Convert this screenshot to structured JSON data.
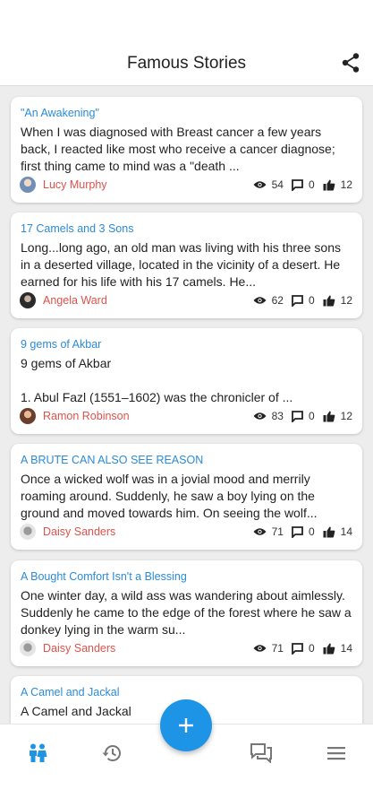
{
  "header": {
    "title": "Famous Stories"
  },
  "stories": [
    {
      "title": "\"An Awakening\"",
      "excerpt": "When I was diagnosed with Breast cancer a few years back, I reacted like most who receive a cancer diagnose; first thing came to mind was a \"death ...",
      "author": "Lucy Murphy",
      "views": "54",
      "comments": "0",
      "likes": "12"
    },
    {
      "title": "17 Camels and 3 Sons",
      "excerpt": "Long...long ago, an old man was living with his three sons in a deserted village, located in the vicinity of a desert. He earned for his life with his 17 camels. He...",
      "author": "Angela Ward",
      "views": "62",
      "comments": "0",
      "likes": "12"
    },
    {
      "title": "9 gems of Akbar",
      "excerpt": "9 gems of Akbar\n\n1. Abul Fazl (1551–1602) was the chronicler of ...",
      "author": "Ramon Robinson",
      "views": "83",
      "comments": "0",
      "likes": "12"
    },
    {
      "title": "A BRUTE CAN ALSO SEE REASON",
      "excerpt": "Once a wicked wolf was in a jovial mood and merrily roaming around. Suddenly, he saw a boy lying on the ground and moved towards him. On seeing the wolf...",
      "author": "Daisy Sanders",
      "views": "71",
      "comments": "0",
      "likes": "14"
    },
    {
      "title": "A Bought Comfort Isn't a Blessing",
      "excerpt": "One winter day, a wild ass was wandering about aimlessly. Suddenly he came to the edge of the forest where he saw a donkey lying in the warm su...",
      "author": "Daisy Sanders",
      "views": "71",
      "comments": "0",
      "likes": "14"
    },
    {
      "title": "A Camel and Jackal",
      "excerpt": "A Camel and Jackal",
      "author": "",
      "views": "",
      "comments": "",
      "likes": ""
    }
  ],
  "icons": {
    "share": "share-icon",
    "views": "eye-icon",
    "comments": "comment-icon",
    "likes": "thumbs-up-icon",
    "nav": [
      "people-icon",
      "history-icon",
      "add-icon",
      "chat-icon",
      "menu-icon"
    ]
  },
  "colors": {
    "accent": "#1e94e6",
    "title_link": "#2a8bd8",
    "author": "#e0524b"
  }
}
